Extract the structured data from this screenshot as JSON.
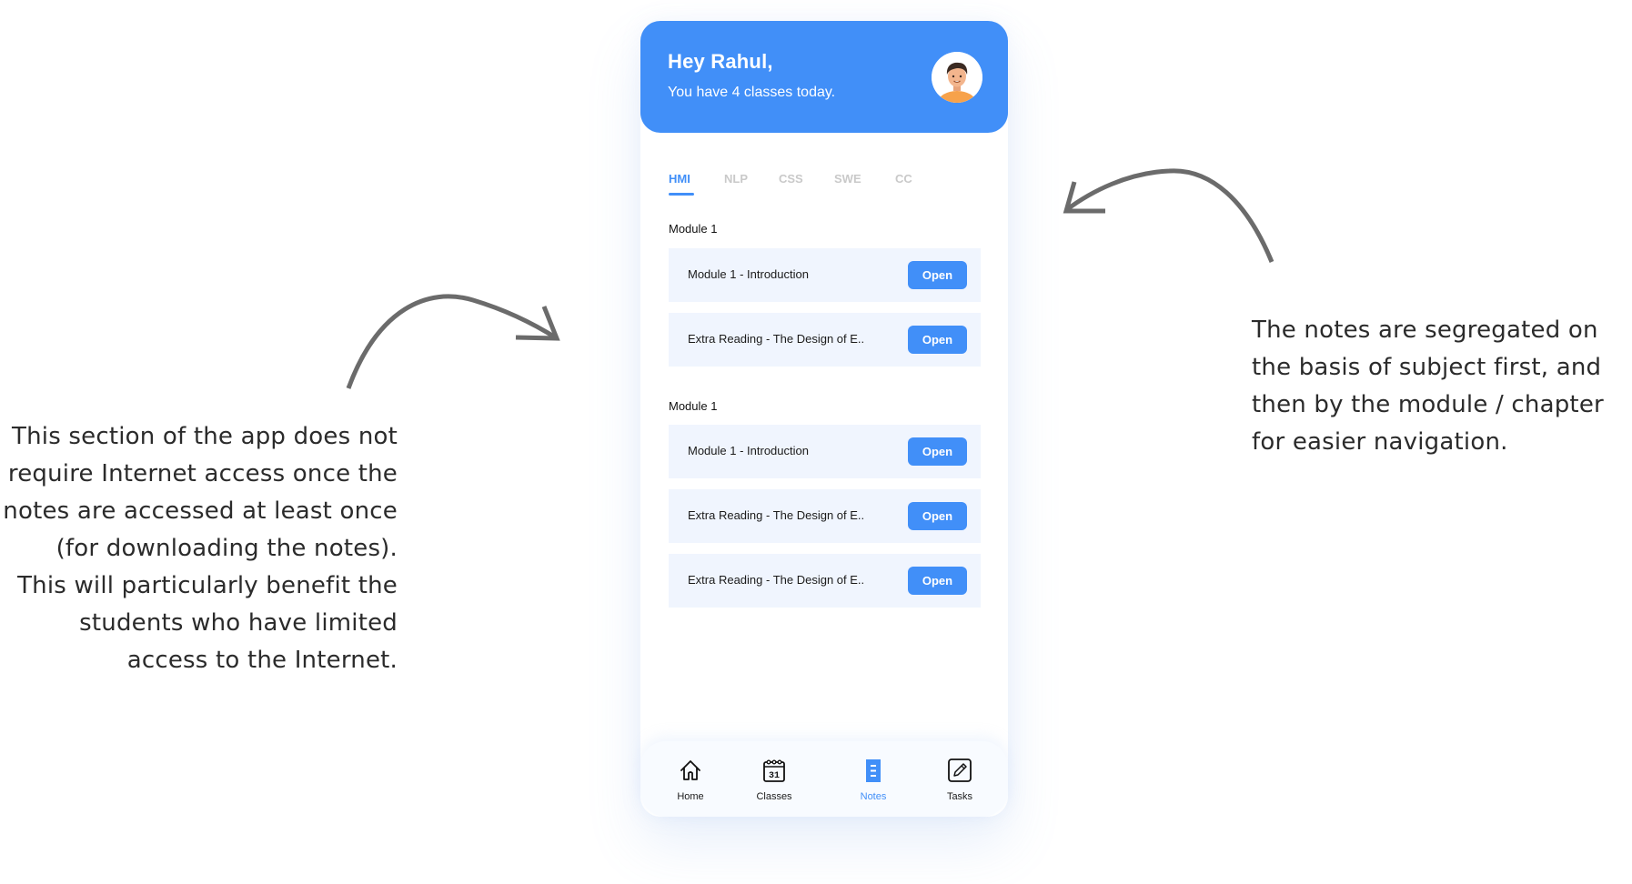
{
  "annotations": {
    "left": {
      "lines": [
        "This section of the app does not",
        "require Internet access once the",
        "notes are accessed at least once",
        "(for downloading the notes).",
        "This will particularly benefit the",
        "students who have limited",
        "access to the Internet."
      ]
    },
    "right": {
      "lines": [
        "The notes are segregated on",
        "the basis of subject first, and",
        "then by the module / chapter",
        "for easier navigation."
      ]
    },
    "arrow_color": "#6b6b6b"
  },
  "app": {
    "brand_color": "#418ff8",
    "header": {
      "greeting": "Hey Rahul,",
      "subtitle": "You have 4 classes today.",
      "avatar_icon": "user-avatar-icon"
    },
    "tabs": [
      {
        "label": "HMI",
        "active": true
      },
      {
        "label": "NLP",
        "active": false
      },
      {
        "label": "CSS",
        "active": false
      },
      {
        "label": "SWE",
        "active": false
      },
      {
        "label": "CC",
        "active": false
      }
    ],
    "sections": [
      {
        "label": "Module 1",
        "items": [
          {
            "title": "Module 1 - Introduction",
            "action": "Open"
          },
          {
            "title": "Extra Reading - The Design of E..",
            "action": "Open"
          }
        ]
      },
      {
        "label": "Module 1",
        "items": [
          {
            "title": "Module 1 - Introduction",
            "action": "Open"
          },
          {
            "title": "Extra Reading - The Design of E..",
            "action": "Open"
          },
          {
            "title": "Extra Reading - The Design of E..",
            "action": "Open"
          }
        ]
      }
    ],
    "bottom_nav": [
      {
        "label": "Home",
        "icon": "home-icon",
        "active": false
      },
      {
        "label": "Classes",
        "icon": "calendar-icon",
        "calendar_day": "31",
        "active": false
      },
      {
        "label": "Notes",
        "icon": "notes-icon",
        "active": true
      },
      {
        "label": "Tasks",
        "icon": "edit-icon",
        "active": false
      }
    ]
  }
}
